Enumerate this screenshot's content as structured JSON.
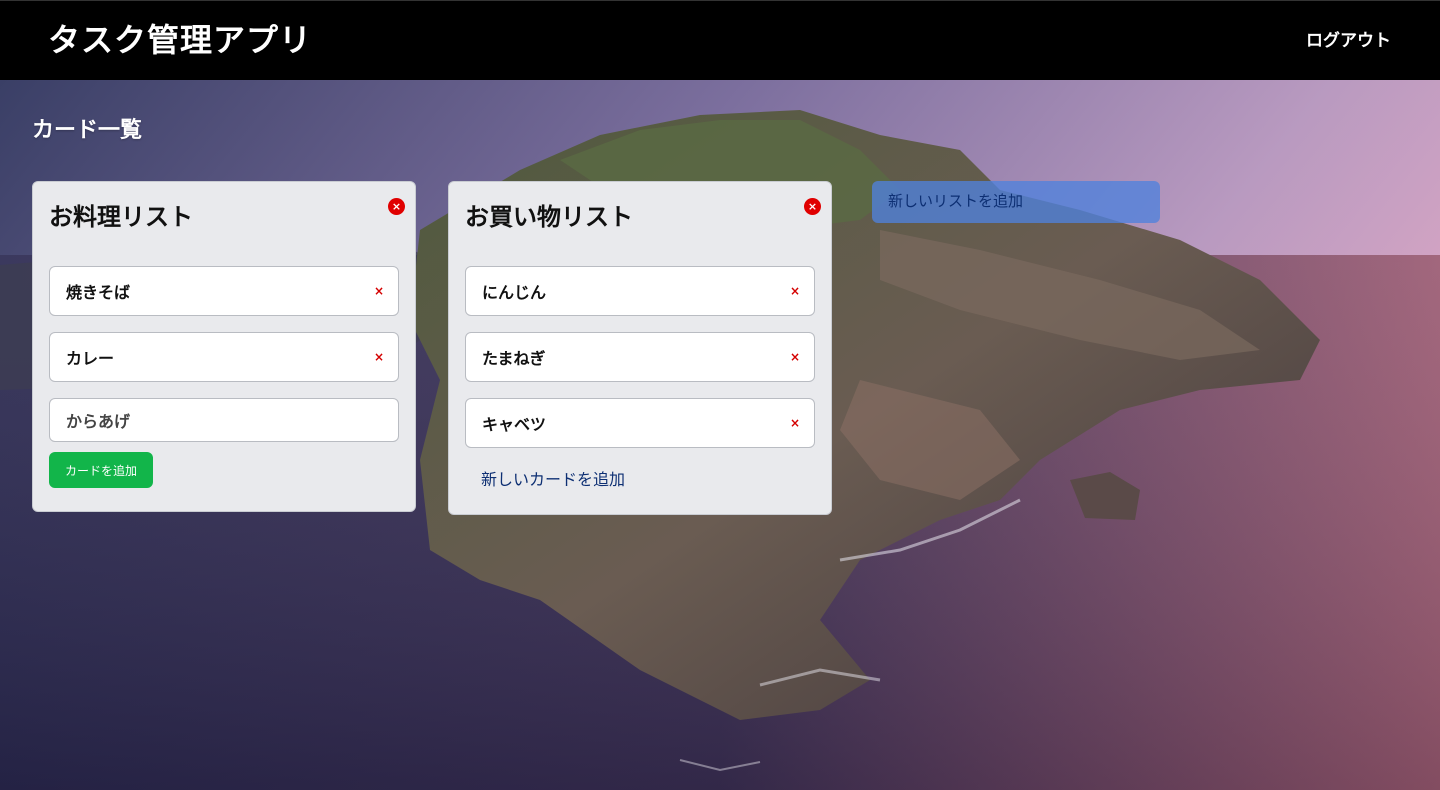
{
  "header": {
    "app_title": "タスク管理アプリ",
    "logout_label": "ログアウト"
  },
  "main": {
    "section_title": "カード一覧",
    "lists": [
      {
        "title": "お料理リスト",
        "delete_glyph": "×",
        "cards": [
          {
            "text": "焼きそば",
            "delete_glyph": "×"
          },
          {
            "text": "カレー",
            "delete_glyph": "×"
          }
        ],
        "new_card_input": {
          "value": "からあげ"
        },
        "add_card_button": "カードを追加"
      },
      {
        "title": "お買い物リスト",
        "delete_glyph": "×",
        "cards": [
          {
            "text": "にんじん",
            "delete_glyph": "×"
          },
          {
            "text": "たまねぎ",
            "delete_glyph": "×"
          },
          {
            "text": "キャベツ",
            "delete_glyph": "×"
          }
        ],
        "add_card_link": "新しいカードを追加"
      }
    ],
    "add_list_label": "新しいリストを追加"
  },
  "colors": {
    "header_bg": "#000000",
    "list_bg": "#e9eaed",
    "delete_red": "#e00000",
    "add_button_green": "#12b54a",
    "link_blue": "#0d2f73"
  }
}
